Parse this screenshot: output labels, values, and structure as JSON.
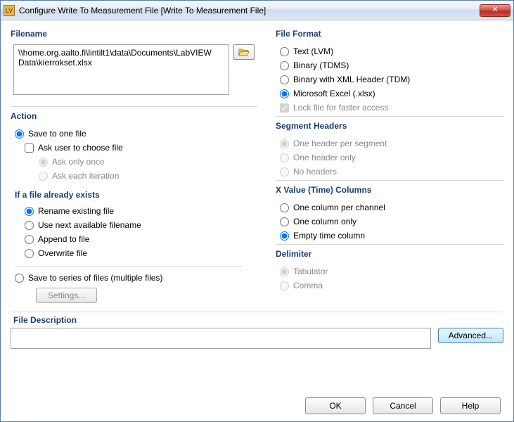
{
  "window": {
    "title": "Configure Write To Measurement File [Write To Measurement File]"
  },
  "filename": {
    "label": "Filename",
    "value": "\\\\home.org.aalto.fi\\lintilt1\\data\\Documents\\LabVIEW Data\\kierrokset.xlsx"
  },
  "action": {
    "label": "Action",
    "radios": {
      "save_one": "Save to one file",
      "ask_user": "Ask user to choose file",
      "ask_once": "Ask only once",
      "ask_each": "Ask each iteration",
      "save_series": "Save to series of files (multiple files)"
    },
    "exists_label": "If a file already exists",
    "exists": {
      "rename": "Rename existing file",
      "next": "Use next available filename",
      "append": "Append to file",
      "overwrite": "Overwrite file"
    },
    "settings_btn": "Settings..."
  },
  "format": {
    "label": "File Format",
    "opts": {
      "lvm": "Text (LVM)",
      "tdms": "Binary (TDMS)",
      "tdm": "Binary with XML Header (TDM)",
      "xlsx": "Microsoft Excel (.xlsx)"
    },
    "lock": "Lock file for faster access"
  },
  "segments": {
    "label": "Segment Headers",
    "opts": {
      "per": "One header per segment",
      "one": "One header only",
      "none": "No headers"
    }
  },
  "xval": {
    "label": "X Value (Time) Columns",
    "opts": {
      "perch": "One column per channel",
      "one": "One column only",
      "empty": "Empty time column"
    }
  },
  "delim": {
    "label": "Delimiter",
    "opts": {
      "tab": "Tabulator",
      "comma": "Comma"
    }
  },
  "desc": {
    "label": "File Description",
    "advanced": "Advanced..."
  },
  "buttons": {
    "ok": "OK",
    "cancel": "Cancel",
    "help": "Help"
  }
}
